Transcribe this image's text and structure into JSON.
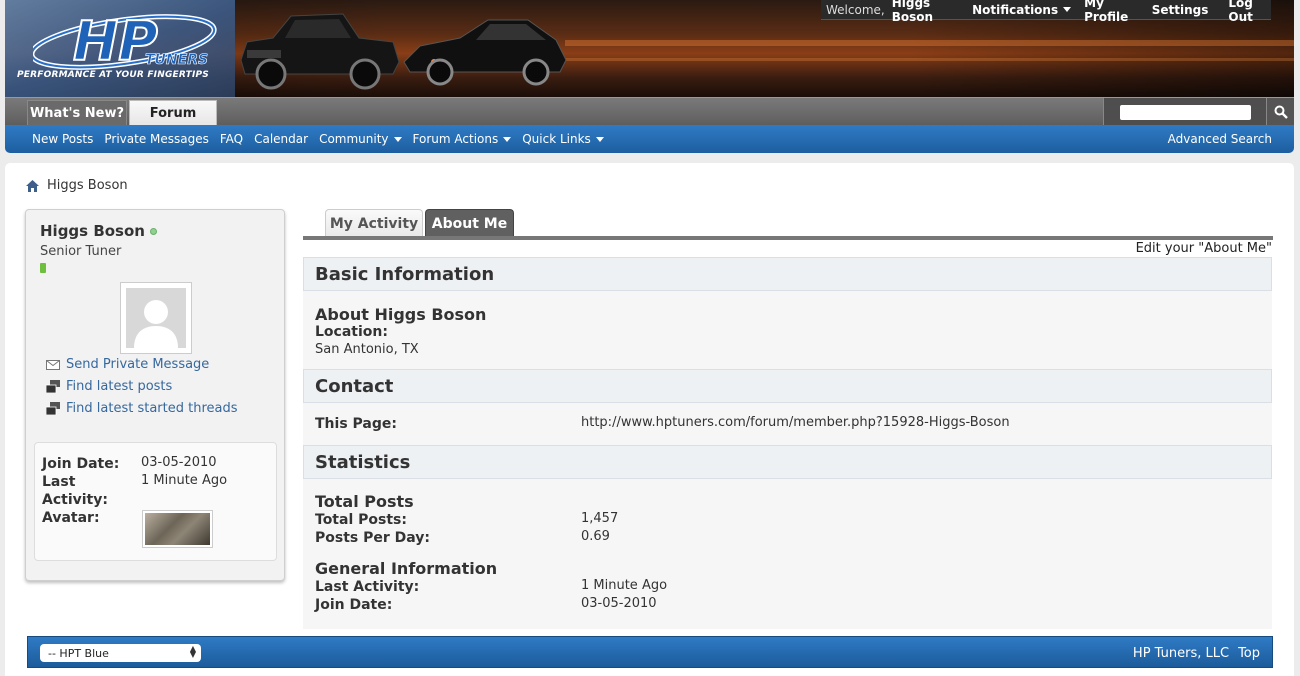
{
  "header": {
    "logo_text": "HP",
    "logo_sub": "TUNERS",
    "tagline": "PERFORMANCE AT YOUR FINGERTIPS",
    "welcome": "Welcome,",
    "username": "Higgs Boson",
    "notifications": "Notifications",
    "my_profile": "My Profile",
    "settings": "Settings",
    "logout": "Log Out"
  },
  "nav": {
    "tabs": [
      {
        "label": "What's New?"
      },
      {
        "label": "Forum"
      }
    ],
    "search_placeholder": ""
  },
  "subnav": {
    "items": [
      {
        "label": "New Posts"
      },
      {
        "label": "Private Messages"
      },
      {
        "label": "FAQ"
      },
      {
        "label": "Calendar"
      },
      {
        "label": "Community"
      },
      {
        "label": "Forum Actions"
      },
      {
        "label": "Quick Links"
      }
    ],
    "advanced_search": "Advanced Search"
  },
  "breadcrumb": {
    "current": "Higgs Boson"
  },
  "sidebar": {
    "name": "Higgs Boson",
    "title": "Senior Tuner",
    "links": [
      {
        "label": "Send Private Message",
        "icon": "mail-icon"
      },
      {
        "label": "Find latest posts",
        "icon": "posts-icon"
      },
      {
        "label": "Find latest started threads",
        "icon": "threads-icon"
      }
    ],
    "info": {
      "join_label": "Join Date:",
      "join_value": "03-05-2010",
      "last_label_1": "Last",
      "last_label_2": "Activity:",
      "last_value": "1 Minute Ago",
      "avatar_label": "Avatar:"
    }
  },
  "profile_tabs": {
    "activity": "My Activity",
    "about": "About Me"
  },
  "edit_about": "Edit your \"About Me\"",
  "about": {
    "basic_header": "Basic Information",
    "about_title": "About Higgs Boson",
    "location_label": "Location:",
    "location_value": "San Antonio, TX",
    "contact_header": "Contact",
    "this_page_label": "This Page:",
    "this_page_value": "http://www.hptuners.com/forum/member.php?15928-Higgs-Boson",
    "stats_header": "Statistics",
    "total_posts_title": "Total Posts",
    "total_posts_label": "Total Posts:",
    "total_posts_value": "1,457",
    "ppd_label": "Posts Per Day:",
    "ppd_value": "0.69",
    "general_title": "General Information",
    "last_activity_label": "Last Activity:",
    "last_activity_value": "1 Minute Ago",
    "join_date_label": "Join Date:",
    "join_date_value": "03-05-2010"
  },
  "footer": {
    "style_select": "-- HPT Blue",
    "company": "HP Tuners, LLC",
    "top": "Top"
  },
  "colors": {
    "nav_blue": "#2f7bc5",
    "link_blue": "#36689e",
    "tab_dark": "#606060"
  }
}
